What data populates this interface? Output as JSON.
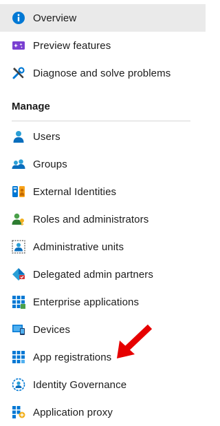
{
  "top_items": [
    {
      "label": "Overview",
      "icon": "info-icon",
      "selected": true
    },
    {
      "label": "Preview features",
      "icon": "preview-features-icon"
    },
    {
      "label": "Diagnose and solve problems",
      "icon": "wrench-icon"
    }
  ],
  "manage": {
    "title": "Manage",
    "items": [
      {
        "label": "Users",
        "icon": "user-icon"
      },
      {
        "label": "Groups",
        "icon": "groups-icon"
      },
      {
        "label": "External Identities",
        "icon": "external-identities-icon"
      },
      {
        "label": "Roles and administrators",
        "icon": "roles-icon"
      },
      {
        "label": "Administrative units",
        "icon": "administrative-units-icon"
      },
      {
        "label": "Delegated admin partners",
        "icon": "delegated-admin-icon"
      },
      {
        "label": "Enterprise applications",
        "icon": "enterprise-apps-icon"
      },
      {
        "label": "Devices",
        "icon": "devices-icon"
      },
      {
        "label": "App registrations",
        "icon": "app-registrations-icon"
      },
      {
        "label": "Identity Governance",
        "icon": "identity-governance-icon"
      },
      {
        "label": "Application proxy",
        "icon": "application-proxy-icon"
      }
    ]
  },
  "colors": {
    "selected_bg": "#eaeaea",
    "accent_blue": "#0078d4",
    "arrow_red": "#e60000"
  }
}
